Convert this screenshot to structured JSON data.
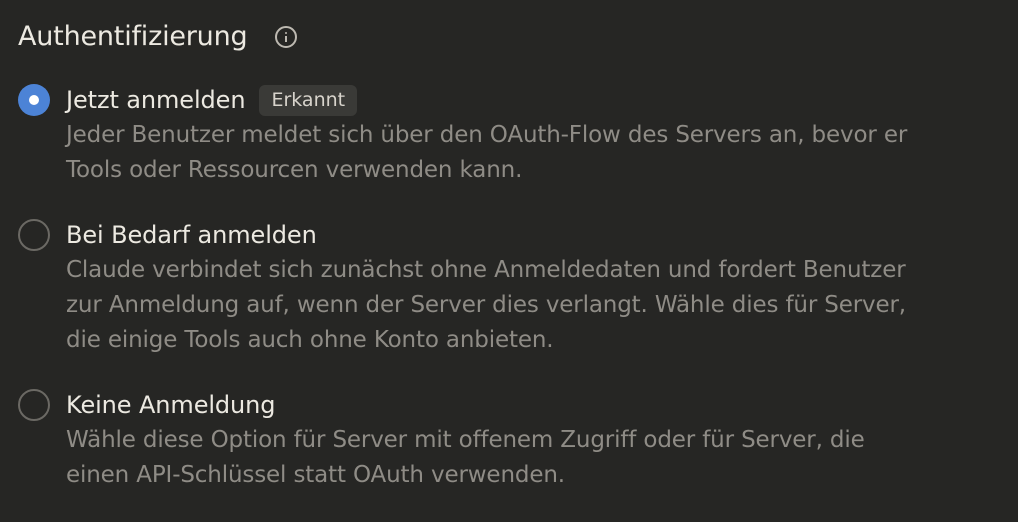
{
  "section": {
    "title": "Authentifizierung",
    "info_icon": "info-icon"
  },
  "options": [
    {
      "label": "Jetzt anmelden",
      "badge": "Erkannt",
      "selected": true,
      "description": "Jeder Benutzer meldet sich über den OAuth-Flow des Servers an, bevor er\nTools oder Ressourcen verwenden kann."
    },
    {
      "label": "Bei Bedarf anmelden",
      "selected": false,
      "description": "Claude verbindet sich zunächst ohne Anmeldedaten und fordert Benutzer\nzur Anmeldung auf, wenn der Server dies verlangt. Wähle dies für Server,\ndie einige Tools auch ohne Konto anbieten."
    },
    {
      "label": "Keine Anmeldung",
      "selected": false,
      "description": "Wähle diese Option für Server mit offenem Zugriff oder für Server, die\neinen API-Schlüssel statt OAuth verwenden."
    }
  ],
  "colors": {
    "background": "#262624",
    "accent": "#4c83d6",
    "text": "#ece9e1",
    "muted_text": "#8f8c86"
  }
}
